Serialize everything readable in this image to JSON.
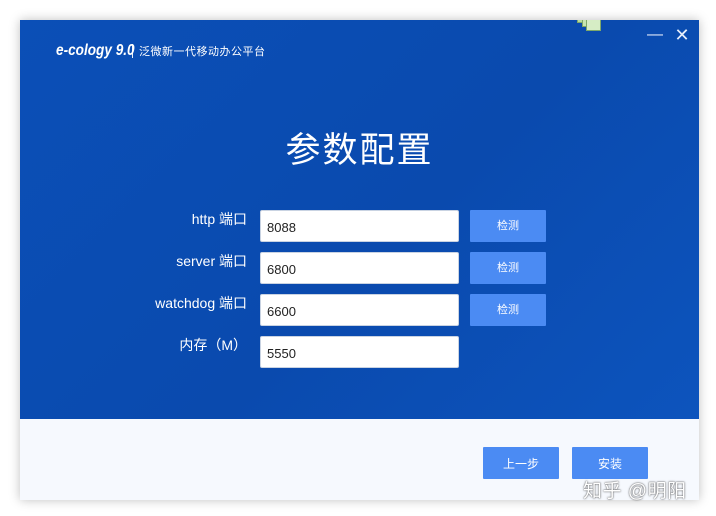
{
  "window": {
    "minimize_glyph": "—",
    "close_glyph": "✕"
  },
  "logo": {
    "brand": "e-cology 9.0",
    "slogan": "泛微新一代移动办公平台"
  },
  "page": {
    "title": "参数配置"
  },
  "form": {
    "fields": [
      {
        "label": "http 端口",
        "value": "8088",
        "check_label": "检测"
      },
      {
        "label": "server 端口",
        "value": "6800",
        "check_label": "检测"
      },
      {
        "label": "watchdog 端口",
        "value": "6600",
        "check_label": "检测"
      },
      {
        "label": "内存（M）",
        "value": "5550"
      }
    ]
  },
  "footer": {
    "prev_label": "上一步",
    "install_label": "安装"
  },
  "watermark": {
    "text": "知乎 @明阳"
  },
  "colors": {
    "primary_blue": "#0b4fb7",
    "button_blue": "#4b8bf3",
    "footer_bg": "#f6f9fe"
  },
  "icons": {
    "deco": "stacked-squares-icon",
    "minimize": "minimize-icon",
    "close": "close-icon"
  }
}
